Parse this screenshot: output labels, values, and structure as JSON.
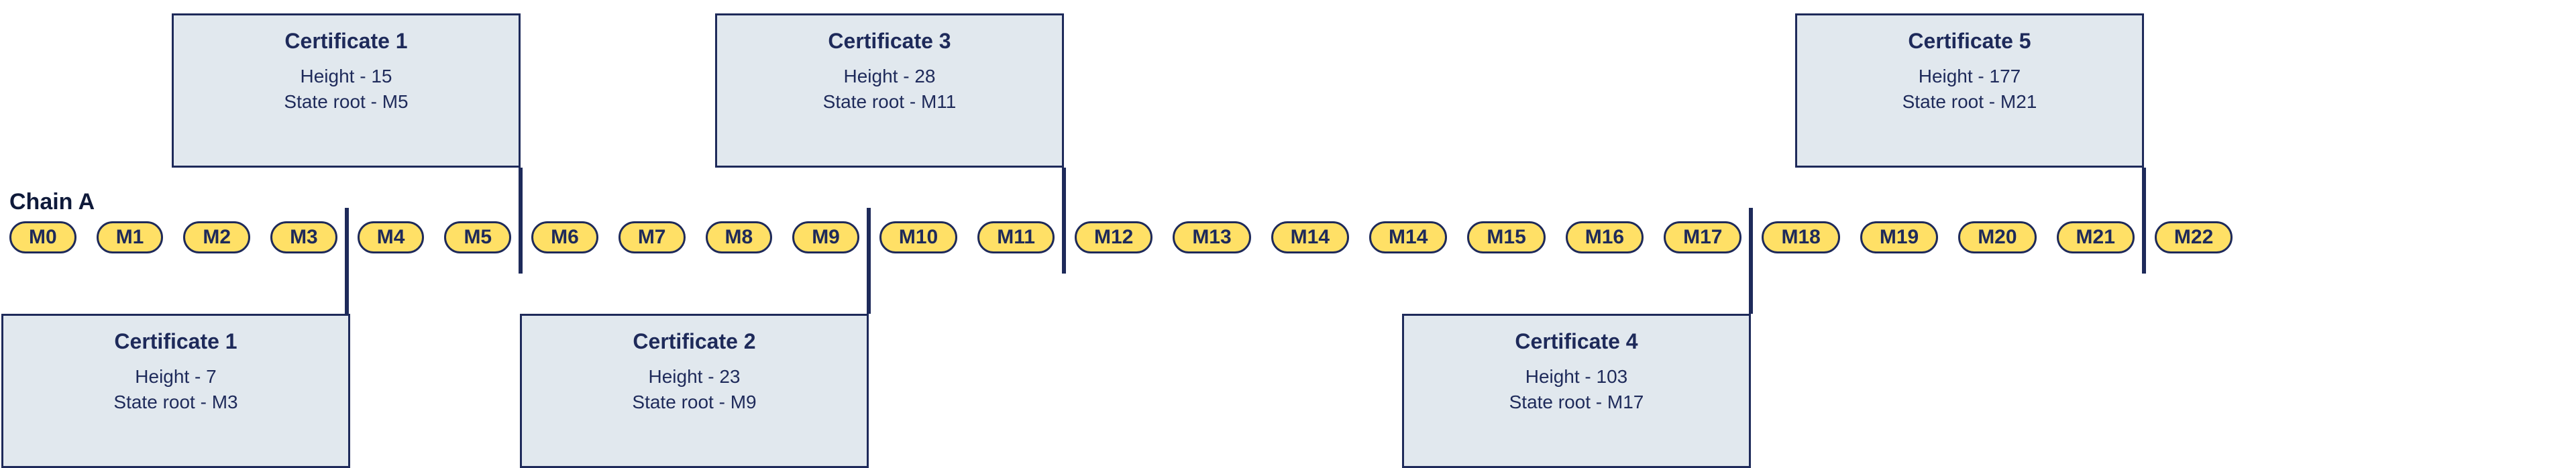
{
  "chain": {
    "label": "Chain A",
    "blocks": [
      "M0",
      "M1",
      "M2",
      "M3",
      "M4",
      "M5",
      "M6",
      "M7",
      "M8",
      "M9",
      "M10",
      "M11",
      "M12",
      "M13",
      "M14",
      "M14",
      "M15",
      "M16",
      "M17",
      "M18",
      "M19",
      "M20",
      "M21",
      "M22"
    ]
  },
  "certificates": [
    {
      "title": "Certificate 1",
      "height": "Height - 7",
      "state_root": "State root - M3",
      "pos": "bottom",
      "anchor": "M3"
    },
    {
      "title": "Certificate 1",
      "height": "Height - 15",
      "state_root": "State root - M5",
      "pos": "top",
      "anchor": "M5"
    },
    {
      "title": "Certificate 2",
      "height": "Height - 23",
      "state_root": "State root - M9",
      "pos": "bottom",
      "anchor": "M9"
    },
    {
      "title": "Certificate 3",
      "height": "Height - 28",
      "state_root": "State root - M11",
      "pos": "top",
      "anchor": "M11"
    },
    {
      "title": "Certificate 4",
      "height": "Height - 103",
      "state_root": "State root - M17",
      "pos": "bottom",
      "anchor": "M17"
    },
    {
      "title": "Certificate 5",
      "height": "Height - 177",
      "state_root": "State root - M21",
      "pos": "top",
      "anchor": "M21"
    }
  ],
  "colors": {
    "ink": "#1e2a5a",
    "pill": "#ffe066",
    "card": "#e1e8ee"
  },
  "chart_data": {
    "type": "diagram",
    "chain_blocks": [
      "M0",
      "M1",
      "M2",
      "M3",
      "M4",
      "M5",
      "M6",
      "M7",
      "M8",
      "M9",
      "M10",
      "M11",
      "M12",
      "M13",
      "M14",
      "M14",
      "M15",
      "M16",
      "M17",
      "M18",
      "M19",
      "M20",
      "M21",
      "M22"
    ],
    "certificates": [
      {
        "index": 1,
        "height": 7,
        "state_root": "M3",
        "position": "below"
      },
      {
        "index": 1,
        "height": 15,
        "state_root": "M5",
        "position": "above"
      },
      {
        "index": 2,
        "height": 23,
        "state_root": "M9",
        "position": "below"
      },
      {
        "index": 3,
        "height": 28,
        "state_root": "M11",
        "position": "above"
      },
      {
        "index": 4,
        "height": 103,
        "state_root": "M17",
        "position": "below"
      },
      {
        "index": 5,
        "height": 177,
        "state_root": "M21",
        "position": "above"
      }
    ]
  }
}
